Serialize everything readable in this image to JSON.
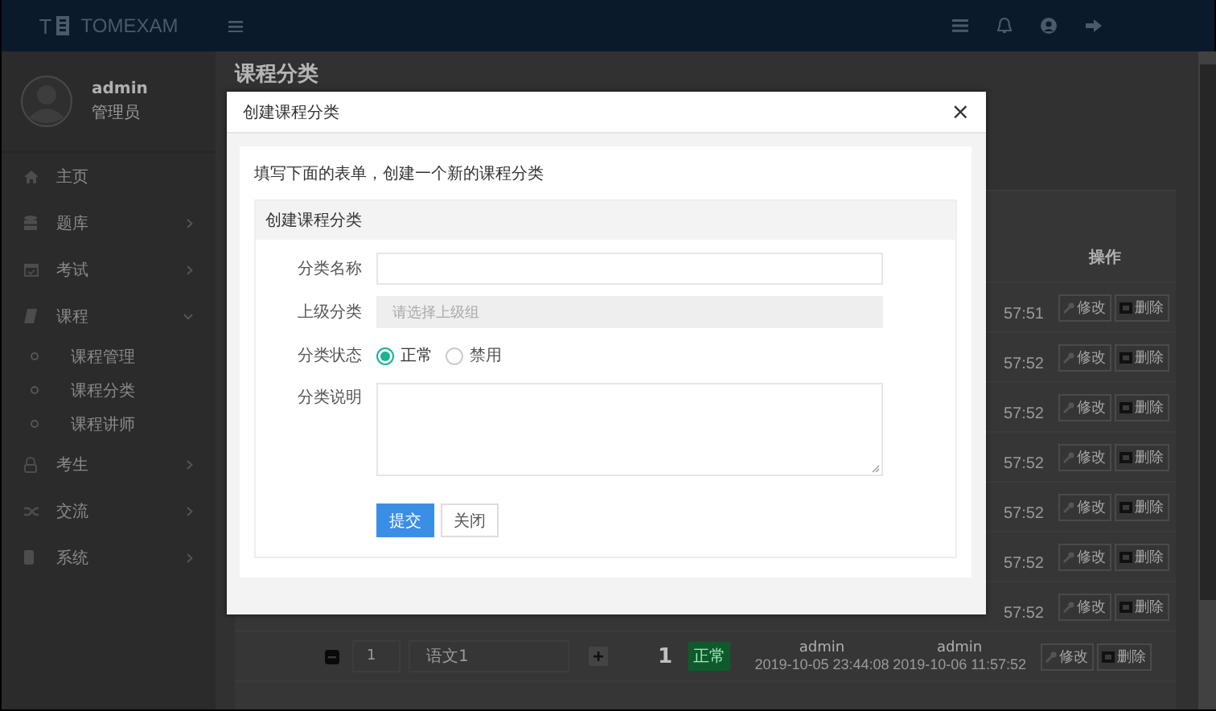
{
  "topbar": {
    "logo_mark": "T",
    "brand": "TOMEXAM"
  },
  "user": {
    "name": "admin",
    "role": "管理员"
  },
  "sidebar": {
    "items": [
      {
        "kind": "link",
        "label": "主页"
      },
      {
        "kind": "group",
        "label": "题库",
        "expanded": false
      },
      {
        "kind": "group",
        "label": "考试",
        "expanded": false
      },
      {
        "kind": "group",
        "label": "课程",
        "expanded": true,
        "children": [
          {
            "label": "课程管理"
          },
          {
            "label": "课程分类"
          },
          {
            "label": "课程讲师"
          }
        ]
      },
      {
        "kind": "group",
        "label": "考生",
        "expanded": false
      },
      {
        "kind": "group",
        "label": "交流",
        "expanded": false
      },
      {
        "kind": "group",
        "label": "系统",
        "expanded": false
      }
    ]
  },
  "page": {
    "title": "课程分类"
  },
  "table": {
    "action_header": "操作",
    "rows": [
      {
        "kind": "partial",
        "updated": "57:51",
        "actions": [
          "修改",
          "删除"
        ]
      },
      {
        "kind": "partial",
        "updated": "57:52",
        "actions": [
          "修改",
          "删除"
        ]
      },
      {
        "kind": "partial",
        "updated": "57:52",
        "actions": [
          "修改",
          "删除"
        ]
      },
      {
        "kind": "partial",
        "updated": "57:52",
        "actions": [
          "修改",
          "删除"
        ]
      },
      {
        "kind": "partial",
        "updated": "57:52",
        "actions": [
          "修改",
          "删除"
        ]
      },
      {
        "kind": "partial",
        "updated": "57:52",
        "actions": [
          "修改",
          "删除"
        ]
      },
      {
        "kind": "partial",
        "updated": "57:52",
        "actions": [
          "修改",
          "删除"
        ]
      },
      {
        "kind": "full",
        "sort": "1",
        "name": "语文1",
        "count": "1",
        "status": "正常",
        "creator": "admin",
        "created": "2019-10-05 23:44:08",
        "updater": "admin",
        "updated": "2019-10-06 11:57:52",
        "actions": [
          "修改",
          "删除"
        ]
      }
    ]
  },
  "modal": {
    "title": "创建课程分类",
    "close": "×",
    "intro": "填写下面的表单，创建一个新的课程分类",
    "section_title": "创建课程分类",
    "fields": [
      {
        "kind": "text",
        "label": "分类名称"
      },
      {
        "kind": "select",
        "label": "上级分类",
        "placeholder": "请选择上级组"
      },
      {
        "kind": "radio",
        "label": "分类状态",
        "options": [
          {
            "label": "正常",
            "selected": true
          },
          {
            "label": "禁用",
            "selected": false
          }
        ]
      },
      {
        "kind": "textarea",
        "label": "分类说明"
      }
    ],
    "buttons": [
      {
        "kind": "primary",
        "label": "提交"
      },
      {
        "kind": "default",
        "label": "关闭"
      }
    ]
  }
}
